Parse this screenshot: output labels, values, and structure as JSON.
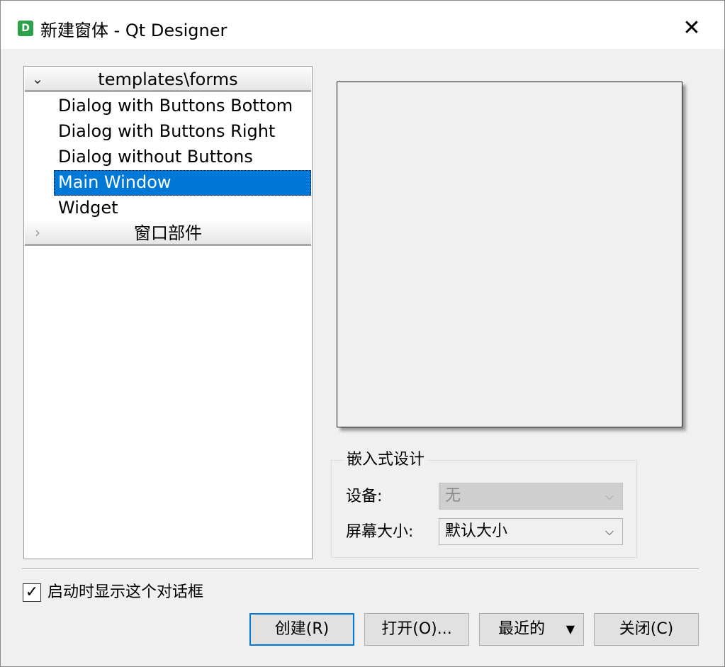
{
  "window": {
    "title": "新建窗体 - Qt Designer",
    "app_icon_letter": "D",
    "close_glyph": "✕"
  },
  "tree": {
    "groups": [
      {
        "label": "templates\\forms",
        "expanded": true,
        "items": [
          {
            "label": "Dialog with Buttons Bottom"
          },
          {
            "label": "Dialog with Buttons Right"
          },
          {
            "label": "Dialog without Buttons"
          },
          {
            "label": "Main Window",
            "selected": true
          },
          {
            "label": "Widget"
          }
        ]
      },
      {
        "label": "窗口部件",
        "expanded": false
      }
    ]
  },
  "embedded": {
    "title": "嵌入式设计",
    "device_label": "设备:",
    "device_value": "无",
    "screen_size_label": "屏幕大小:",
    "screen_size_value": "默认大小"
  },
  "footer": {
    "show_on_startup_label": "启动时显示这个对话框",
    "show_on_startup_checked": true,
    "checkmark": "✓",
    "buttons": {
      "create": "创建(R)",
      "open": "打开(O)...",
      "recent": "最近的",
      "close": "关闭(C)"
    }
  },
  "icons": {
    "expanded": "chevron-down-icon",
    "collapsed": "chevron-right-icon",
    "combo_arrow": "chevron-down-icon",
    "menu_arrow": "triangle-down-icon"
  },
  "colors": {
    "selection": "#0078d7",
    "app_icon": "#2ca24a"
  }
}
